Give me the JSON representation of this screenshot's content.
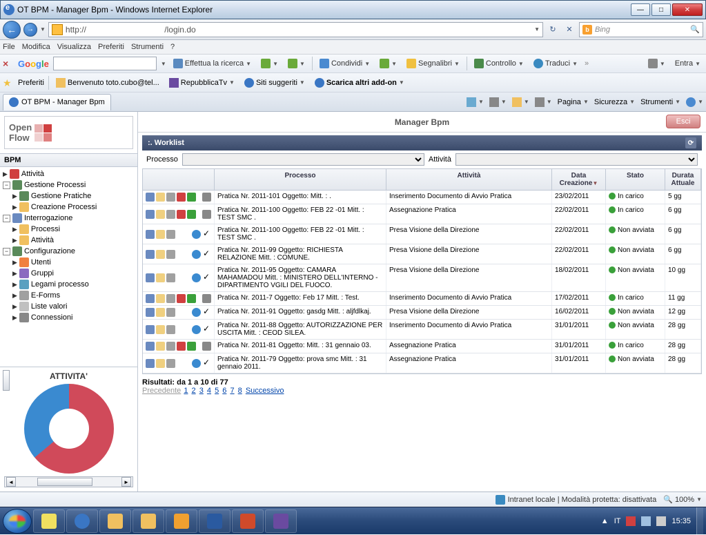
{
  "window": {
    "title": "OT BPM - Manager Bpm - Windows Internet Explorer"
  },
  "ie": {
    "url": "http://                                  /login.do",
    "search_engine": "Bing",
    "menu": {
      "file": "File",
      "modifica": "Modifica",
      "visualizza": "Visualizza",
      "preferiti": "Preferiti",
      "strumenti": "Strumenti",
      "q": "?"
    },
    "google_tb": {
      "brand": {
        "g1": "G",
        "o1": "o",
        "o2": "o",
        "g2": "g",
        "l": "l",
        "e": "e"
      },
      "ricerca": "Effettua la ricerca",
      "condividi": "Condividi",
      "segnalibri": "Segnalibri",
      "controllo": "Controllo",
      "traduci": "Traduci",
      "entra": "Entra"
    },
    "fav": {
      "label": "Preferiti",
      "benvenuto": "Benvenuto toto.cubo@tel...",
      "repubblica": "RepubblicaTv",
      "siti": "Siti suggeriti",
      "scarica": "Scarica altri add-on"
    },
    "tab": "OT BPM - Manager Bpm",
    "page_tools": {
      "pagina": "Pagina",
      "sicurezza": "Sicurezza",
      "strumenti": "Strumenti"
    },
    "status": {
      "zone": "Intranet locale | Modalità protetta: disattivata",
      "zoom": "100%"
    }
  },
  "app": {
    "logo": {
      "open": "Open",
      "flow": "Flow"
    },
    "title": "Manager Bpm",
    "esci": "Esci",
    "bpm_head": "BPM",
    "tree": {
      "attivita": "Attività",
      "gestione_processi": "Gestione Processi",
      "gestione_pratiche": "Gestione Pratiche",
      "creazione_processi": "Creazione Processi",
      "interrogazione": "Interrogazione",
      "processi": "Processi",
      "attivita2": "Attività",
      "configurazione": "Configurazione",
      "utenti": "Utenti",
      "gruppi": "Gruppi",
      "legami": "Legami processo",
      "eforms": "E-Forms",
      "liste": "Liste valori",
      "connessioni": "Connessioni"
    },
    "chart_title": "ATTIVITA'"
  },
  "worklist": {
    "header": ":. Worklist",
    "filter": {
      "processo": "Processo",
      "attivita": "Attività"
    },
    "cols": {
      "processo": "Processo",
      "attivita": "Attività",
      "data": "Data Creazione",
      "stato": "Stato",
      "durata": "Durata Attuale"
    },
    "rows": [
      {
        "proc": "Pratica Nr. 2011-101 Oggetto: Mitt. : .",
        "att": "Inserimento Documento di Avvio Pratica",
        "date": "23/02/2011",
        "stato": "In carico",
        "dur": "5 gg",
        "variant": "trash"
      },
      {
        "proc": "Pratica Nr. 2011-100 Oggetto: FEB 22 -01 Mitt. : TEST SMC .",
        "att": "Assegnazione Pratica",
        "date": "22/02/2011",
        "stato": "In carico",
        "dur": "6 gg",
        "variant": "trash"
      },
      {
        "proc": "Pratica Nr. 2011-100 Oggetto: FEB 22 -01 Mitt. : TEST SMC .",
        "att": "Presa Visione della Direzione",
        "date": "22/02/2011",
        "stato": "Non avviata",
        "dur": "6 gg",
        "variant": "info"
      },
      {
        "proc": "Pratica Nr. 2011-99 Oggetto: RICHIESTA RELAZIONE Mitt. : COMUNE.",
        "att": "Presa Visione della Direzione",
        "date": "22/02/2011",
        "stato": "Non avviata",
        "dur": "6 gg",
        "variant": "info"
      },
      {
        "proc": "Pratica Nr. 2011-95 Oggetto: CAMARA MAHAMADOU Mitt. : MINISTERO DELL'INTERNO - DIPARTIMENTO VGILI DEL FUOCO.",
        "att": "Presa Visione della Direzione",
        "date": "18/02/2011",
        "stato": "Non avviata",
        "dur": "10 gg",
        "variant": "info"
      },
      {
        "proc": "Pratica Nr. 2011-7 Oggetto: Feb 17 Mitt. : Test.",
        "att": "Inserimento Documento di Avvio Pratica",
        "date": "17/02/2011",
        "stato": "In carico",
        "dur": "11 gg",
        "variant": "trash"
      },
      {
        "proc": "Pratica Nr. 2011-91 Oggetto: gasdg Mitt. : aljfdlkaj.",
        "att": "Presa Visione della Direzione",
        "date": "16/02/2011",
        "stato": "Non avviata",
        "dur": "12 gg",
        "variant": "info"
      },
      {
        "proc": "Pratica Nr. 2011-88 Oggetto: AUTORIZZAZIONE PER USCITA Mitt. : CEOD SILEA.",
        "att": "Inserimento Documento di Avvio Pratica",
        "date": "31/01/2011",
        "stato": "Non avviata",
        "dur": "28 gg",
        "variant": "info"
      },
      {
        "proc": "Pratica Nr. 2011-81 Oggetto: Mitt. : 31 gennaio 03.",
        "att": "Assegnazione Pratica",
        "date": "31/01/2011",
        "stato": "In carico",
        "dur": "28 gg",
        "variant": "trash"
      },
      {
        "proc": "Pratica Nr. 2011-79 Oggetto: prova smc Mitt. : 31 gennaio 2011.",
        "att": "Assegnazione Pratica",
        "date": "31/01/2011",
        "stato": "Non avviata",
        "dur": "28 gg",
        "variant": "info"
      }
    ],
    "pager": {
      "summary": "Risultati: da 1 a 10 di 77",
      "prev": "Precedente",
      "next": "Successivo",
      "pages": [
        "1",
        "2",
        "3",
        "4",
        "5",
        "6",
        "7",
        "8"
      ]
    }
  },
  "taskbar": {
    "lang": "IT",
    "time": "15:35"
  },
  "chart_data": {
    "type": "pie",
    "title": "ATTIVITA'",
    "series": [
      {
        "name": "Red",
        "value": 64,
        "color": "#d04a5a"
      },
      {
        "name": "Blue",
        "value": 36,
        "color": "#3a8ad0"
      }
    ]
  }
}
